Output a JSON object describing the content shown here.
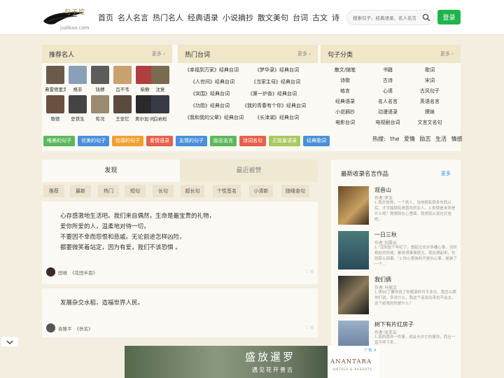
{
  "header": {
    "logo_text": "句子控",
    "logo_url": "juzikao.com",
    "nav": [
      "首页",
      "名人名言",
      "热门名人",
      "经典语录",
      "小说摘抄",
      "散文美句",
      "台词",
      "古文",
      "诗"
    ],
    "search_placeholder": "搜索句子、经典语录、名人名言",
    "login_label": "登录"
  },
  "celebs_panel": {
    "title": "推荐名人",
    "more": "更多",
    "people": [
      "弗雷德里克",
      "格非",
      "钱穆",
      "吕不韦",
      "柴静",
      "沈复",
      "歌德",
      "史铁生",
      "荀况",
      "王安忆",
      "奥尔加·托",
      "白岩松"
    ]
  },
  "lines_panel": {
    "title": "热门台词",
    "more": "更多",
    "rows": [
      [
        "《幸福到万家》经典台词",
        "《梦华录》经典台词"
      ],
      [
        "《人世间》经典台词",
        "《当家主母》经典台词"
      ],
      [
        "《突围》经典台词",
        "《第一炉香》经典台词"
      ],
      [
        "《功勋》经典台词",
        "《我的青春有个你》经典台词"
      ],
      [
        "《我和我的父辈》经典台词",
        "《长津湖》经典台词"
      ]
    ]
  },
  "cats_panel": {
    "title": "句子分类",
    "more": "更多",
    "rows": [
      [
        "散文/随笔",
        "书籍",
        "歌词"
      ],
      [
        "诗歌",
        "古诗",
        "宋词"
      ],
      [
        "格言",
        "心语",
        "古风句子"
      ],
      [
        "经典语录",
        "名人名言",
        "英语名言"
      ],
      [
        "小说摘抄",
        "动漫语录",
        "撩妹"
      ],
      [
        "电影台词",
        "电视剧台词",
        "文言文名句"
      ]
    ]
  },
  "tags": [
    {
      "label": "唯美的句子",
      "color": "#5cb85c"
    },
    {
      "label": "优美的句子",
      "color": "#4a90d9"
    },
    {
      "label": "伤感的句子",
      "color": "#f0a030"
    },
    {
      "label": "爱情语录",
      "color": "#e8604c"
    },
    {
      "label": "友情的句子",
      "color": "#4a90d9"
    },
    {
      "label": "励志名言",
      "color": "#5cb85c"
    },
    {
      "label": "诗词名句",
      "color": "#e8604c"
    },
    {
      "label": "正能量语录",
      "color": "#a8c860"
    },
    {
      "label": "经典歌词",
      "color": "#4a90d9"
    }
  ],
  "hot_search": {
    "label": "热搜:",
    "terms": [
      "the",
      "爱情",
      "励志",
      "生活",
      "情感"
    ]
  },
  "feed": {
    "tabs": [
      "发现",
      "最近被赞"
    ],
    "filters": [
      "推荐",
      "最新",
      "热门",
      "短句",
      "长句",
      "超长句",
      "个性签名",
      "小清新",
      "随缘金句"
    ],
    "cards": [
      {
        "lines": [
          "心存感激地生活吧。我们来自偶然，生命是最宝贵的礼物，",
          "爱你所爱的人，温柔地对待一切，",
          "不要因不幸而怨恨和悲戚。无论前途怎样凶险，",
          "都要微笑着站定，因为有爱，我们不该恐惧 。"
        ],
        "author": "田维",
        "source": "《花田半亩》",
        "likes": "0"
      },
      {
        "lines": [
          "发展杂交水稻，造福世界人民。"
        ],
        "author": "袁隆平",
        "source": "《佚名》",
        "likes": "0"
      }
    ]
  },
  "sidebar": {
    "title": "最新收录名言作品",
    "more": "更多",
    "works": [
      {
        "title": "观音山",
        "author": "作者:李玉",
        "desc": "1.我总觉得，一个男人，当他拥有很多东西以后，才可能拥有她喜欢的女人。2.即使是未来是什么呢？我想就在心里面，我想就从现在开始吧。"
      },
      {
        "title": "一日三秋",
        "author": "作者:刘震云",
        "desc": "1.\"活到这个年纪了，想起过去许多糟心事，当时相处的时候，都觉得事情很大，现在想起来，也就那么回事。\"2.你心里装的不是仇心事，是装了一个..."
      },
      {
        "title": "我们俩",
        "author": "作者:马俪文",
        "desc": "1.快90了要你说了你根源的可不多见。我怎么跟你们说，多说什么，我这个话说出来也不会太，这个给我的你是什么？"
      },
      {
        "title": "树下有片红房子",
        "author": "作者:张芙友",
        "desc": "1.真的喜欢一件事，就会允许它伤害你，而且一直不停下来..."
      }
    ]
  },
  "ad": {
    "headline": "盛放暹罗",
    "sub": "遇见花开普吉",
    "brand": "ANANTARA",
    "brand_sub": "HOTELS & RESORTS",
    "ad_label": "广告"
  },
  "colors": {
    "accent_green": "#1fb44c",
    "panel_head": "#f0e6c8",
    "bg": "#f3eee0"
  }
}
